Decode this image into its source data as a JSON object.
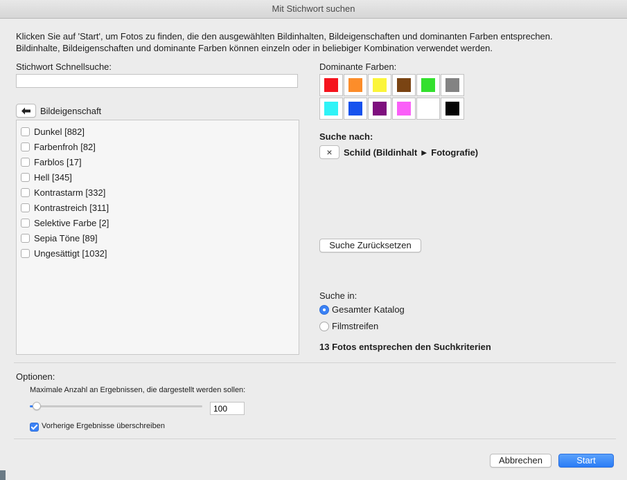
{
  "window": {
    "title": "Mit Stichwort suchen"
  },
  "intro": {
    "line1": "Klicken Sie auf 'Start', um Fotos zu finden, die den ausgewählten Bildinhalten, Bildeigenschaften und dominanten Farben entsprechen.",
    "line2": "Bildinhalte, Bildeigenschaften und dominante Farben können einzeln oder in beliebiger Kombination verwendet werden."
  },
  "quicksearch": {
    "label": "Stichwort Schnellsuche:",
    "value": ""
  },
  "properties": {
    "label": "Bildeigenschaft",
    "items": [
      {
        "label": "Dunkel [882]",
        "checked": false
      },
      {
        "label": "Farbenfroh [82]",
        "checked": false
      },
      {
        "label": "Farblos [17]",
        "checked": false
      },
      {
        "label": "Hell [345]",
        "checked": false
      },
      {
        "label": "Kontrastarm [332]",
        "checked": false
      },
      {
        "label": "Kontrastreich [311]",
        "checked": false
      },
      {
        "label": "Selektive Farbe [2]",
        "checked": false
      },
      {
        "label": "Sepia Töne [89]",
        "checked": false
      },
      {
        "label": "Ungesättigt [1032]",
        "checked": false
      }
    ]
  },
  "colors": {
    "label": "Dominante Farben:",
    "swatches": [
      "#f5141e",
      "#fc8d2a",
      "#fbf53a",
      "#7a4413",
      "#34e02e",
      "#838383",
      "#2ff3f7",
      "#1652ee",
      "#7e0f7e",
      "#fa5ff8",
      "#ffffff",
      "#050505"
    ]
  },
  "search_for": {
    "label": "Suche nach:",
    "remove_icon": "×",
    "term": "Schild (Bildinhalt ► Fotografie)"
  },
  "reset_button": "Suche Zurücksetzen",
  "search_in": {
    "label": "Suche in:",
    "options": [
      {
        "label": "Gesamter Katalog",
        "selected": true
      },
      {
        "label": "Filmstreifen",
        "selected": false
      }
    ]
  },
  "result_text": "13 Fotos entsprechen den Suchkriterien",
  "options": {
    "label": "Optionen:",
    "max_label": "Maximale Anzahl an Ergebnissen, die dargestellt werden sollen:",
    "max_value": "100",
    "slider_fraction": 0.04,
    "overwrite_label": "Vorherige Ergebnisse überschreiben",
    "overwrite_checked": true
  },
  "buttons": {
    "cancel": "Abbrechen",
    "start": "Start"
  }
}
